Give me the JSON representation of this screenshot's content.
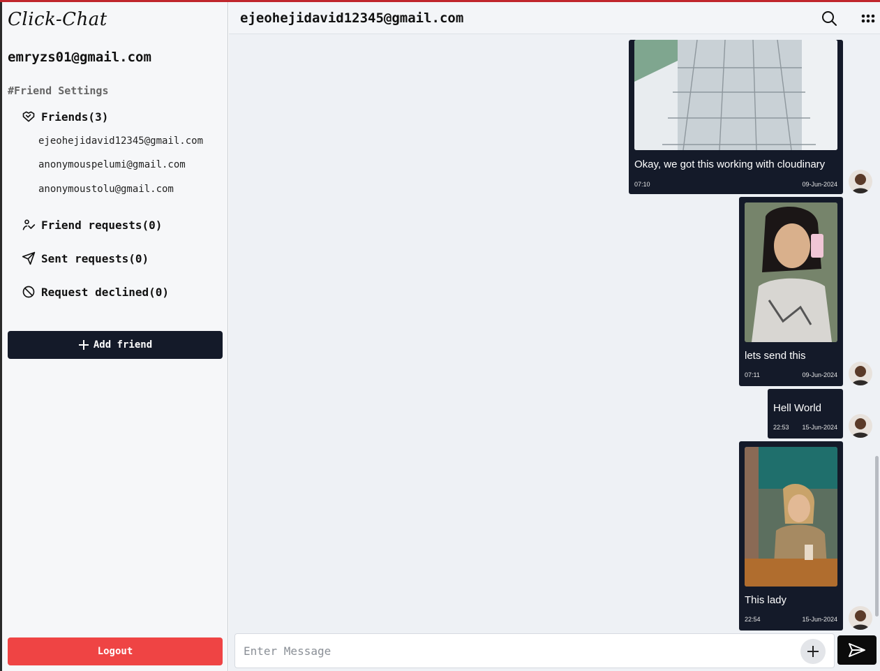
{
  "app": {
    "logo": "Click-Chat"
  },
  "sidebar": {
    "user_email": "emryzs01@gmail.com",
    "section_title": "#Friend Settings",
    "friends_label": "Friends(3)",
    "friends": [
      "ejeohejidavid12345@gmail.com",
      "anonymouspelumi@gmail.com",
      "anonymoustolu@gmail.com"
    ],
    "friend_requests_label": "Friend requests(0)",
    "sent_requests_label": "Sent requests(0)",
    "request_declined_label": "Request declined(0)",
    "add_friend_label": "Add friend",
    "logout_label": "Logout"
  },
  "chat": {
    "title": "ejeohejidavid12345@gmail.com",
    "messages": [
      {
        "text": "Okay, we got this working with cloudinary",
        "time": "07:10",
        "date": "09-Jun-2024",
        "has_image": true
      },
      {
        "text": "lets send this",
        "time": "07:11",
        "date": "09-Jun-2024",
        "has_image": true
      },
      {
        "text": "Hell World",
        "time": "22:53",
        "date": "15-Jun-2024",
        "has_image": false
      },
      {
        "text": "This lady",
        "time": "22:54",
        "date": "15-Jun-2024",
        "has_image": true
      }
    ],
    "input": {
      "placeholder": "Enter Message",
      "value": ""
    }
  },
  "colors": {
    "accent_dark": "#141a29",
    "danger": "#ef4444",
    "top_border": "#c0262c"
  },
  "icons": [
    "search-icon",
    "grid-menu-icon",
    "handshake-icon",
    "friend-request-icon",
    "send-request-icon",
    "ban-icon",
    "plus-icon",
    "send-icon"
  ]
}
